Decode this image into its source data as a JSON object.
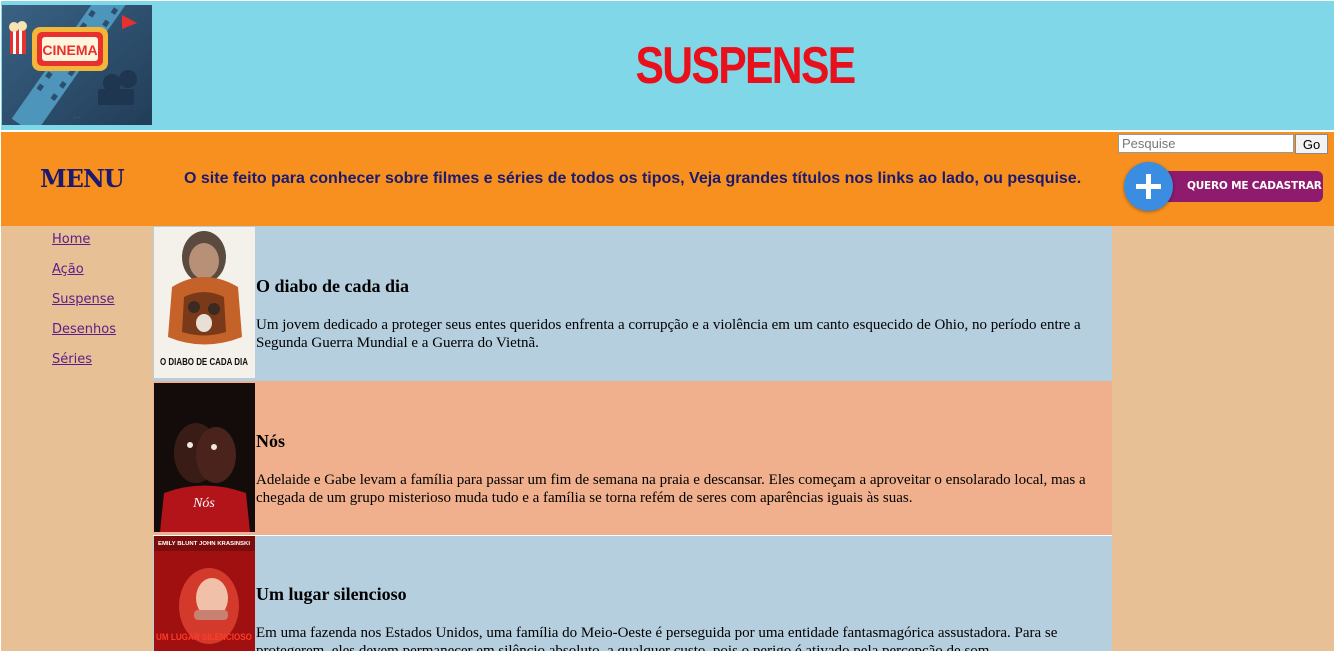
{
  "header": {
    "logo_text": "CINEMA",
    "title": "SUSPENSE"
  },
  "topbar": {
    "menu_title": "MENU",
    "tagline": "O site feito para conhecer sobre filmes e séries de todos os tipos, Veja grandes títulos nos links ao lado, ou pesquise.",
    "search": {
      "placeholder": "Pesquise",
      "value": ""
    },
    "go_label": "Go",
    "signup_label": "QUERO ME CADASTRAR"
  },
  "sidebar": {
    "items": [
      {
        "label": "Home"
      },
      {
        "label": "Ação"
      },
      {
        "label": "Suspense"
      },
      {
        "label": "Desenhos"
      },
      {
        "label": "Séries"
      }
    ]
  },
  "movies": [
    {
      "title": "O diabo de cada dia",
      "poster_text": "O DIABO DE CADA DIA",
      "description": "Um jovem dedicado a proteger seus entes queridos enfrenta a corrupção e a violência em um canto esquecido de Ohio, no período entre a Segunda Guerra Mundial e a Guerra do Vietnã."
    },
    {
      "title": "Nós",
      "poster_text": "Nós",
      "description": "Adelaide e Gabe levam a família para passar um fim de semana na praia e descansar. Eles começam a aproveitar o ensolarado local, mas a chegada de um grupo misterioso muda tudo e a família se torna refém de seres com aparências iguais às suas."
    },
    {
      "title": "Um lugar silencioso",
      "poster_text": "UM LUGAR SILENCIOSO",
      "poster_names": "EMILY BLUNT   JOHN KRASINSKI",
      "description": "Em uma fazenda nos Estados Unidos, uma família do Meio-Oeste é perseguida por uma entidade fantasmagórica assustadora. Para se protegerem, eles devem permanecer em silêncio absoluto, a qualquer custo, pois o perigo é ativado pela percepção de som."
    }
  ],
  "colors": {
    "header_bg": "#80d7e8",
    "title_red": "#e8101b",
    "topbar_bg": "#f7901e",
    "navy_text": "#1b1a6e",
    "sidebar_bg": "#e8c096",
    "row_blue": "#b5cfdf",
    "row_salmon": "#f0b08d",
    "link_purple": "#5b1d87",
    "signup_purple": "#8e1b6d",
    "signup_blue": "#3a8de0"
  },
  "icons": {
    "logo": "cinema-logo-icon",
    "signup": "plus-icon"
  }
}
